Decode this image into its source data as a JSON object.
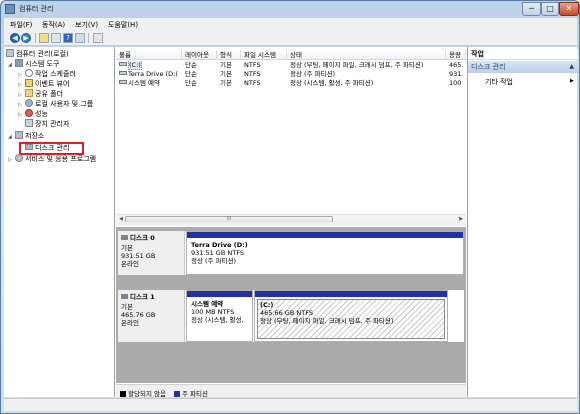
{
  "window": {
    "title": "컴퓨터 관리",
    "min": "─",
    "max": "□",
    "close": "✕"
  },
  "menu": [
    "파일(F)",
    "동작(A)",
    "보기(V)",
    "도움말(H)"
  ],
  "tree": {
    "root": "컴퓨터 관리(로컬)",
    "system_tools": "시스템 도구",
    "task_scheduler": "작업 스케줄러",
    "event_viewer": "이벤트 뷰어",
    "shared_folders": "공유 폴더",
    "local_users": "로컬 사용자 및 그룹",
    "performance": "성능",
    "device_manager": "장치 관리자",
    "storage": "저장소",
    "disk_management": "디스크 관리",
    "services": "서비스 및 응용 프로그램"
  },
  "volume_list": {
    "columns": [
      "볼륨",
      "레이아웃",
      "형식",
      "파일 시스템",
      "상태",
      "용량"
    ],
    "rows": [
      {
        "volume": "(C:)",
        "layout": "단순",
        "type": "기본",
        "fs": "NTFS",
        "status": "정상 (부팅, 페이지 파일, 크래시 덤프, 주 파티션)",
        "capacity": "465."
      },
      {
        "volume": "Terra Drive (D:)",
        "layout": "단순",
        "type": "기본",
        "fs": "NTFS",
        "status": "정상 (주 파티션)",
        "capacity": "931."
      },
      {
        "volume": "시스템 예약",
        "layout": "단순",
        "type": "기본",
        "fs": "NTFS",
        "status": "정상 (시스템, 활성, 주 파티션)",
        "capacity": "100"
      }
    ],
    "scroll_thumb": "III"
  },
  "disks": [
    {
      "name": "디스크 0",
      "type": "기본",
      "size": "931.51 GB",
      "state": "온라인",
      "partitions": [
        {
          "name": "Terra Drive  (D:)",
          "size": "931.51 GB NTFS",
          "status": "정상 (주 파티션)"
        }
      ]
    },
    {
      "name": "디스크 1",
      "type": "기본",
      "size": "465.76 GB",
      "state": "온라인",
      "partitions": [
        {
          "name": "시스템 예약",
          "size": "100 MB NTFS",
          "status": "정상 (시스템, 활성,"
        },
        {
          "name": "(C:)",
          "size": "465.66 GB NTFS",
          "status": "정상 (부팅, 페이지 파일, 크래시 덤프, 주 파티션)"
        }
      ]
    }
  ],
  "legend": [
    {
      "label": "할당되지 않음",
      "color": "#000000"
    },
    {
      "label": "주 파티션",
      "color": "#1f33a8"
    }
  ],
  "actions": {
    "header": "작업",
    "section": "디스크 관리",
    "more": "기타 작업",
    "arrow_up": "▲",
    "arrow_right": "▶"
  },
  "colors": {
    "partition_bar": "#1f33a8",
    "highlight": "#e02020"
  }
}
